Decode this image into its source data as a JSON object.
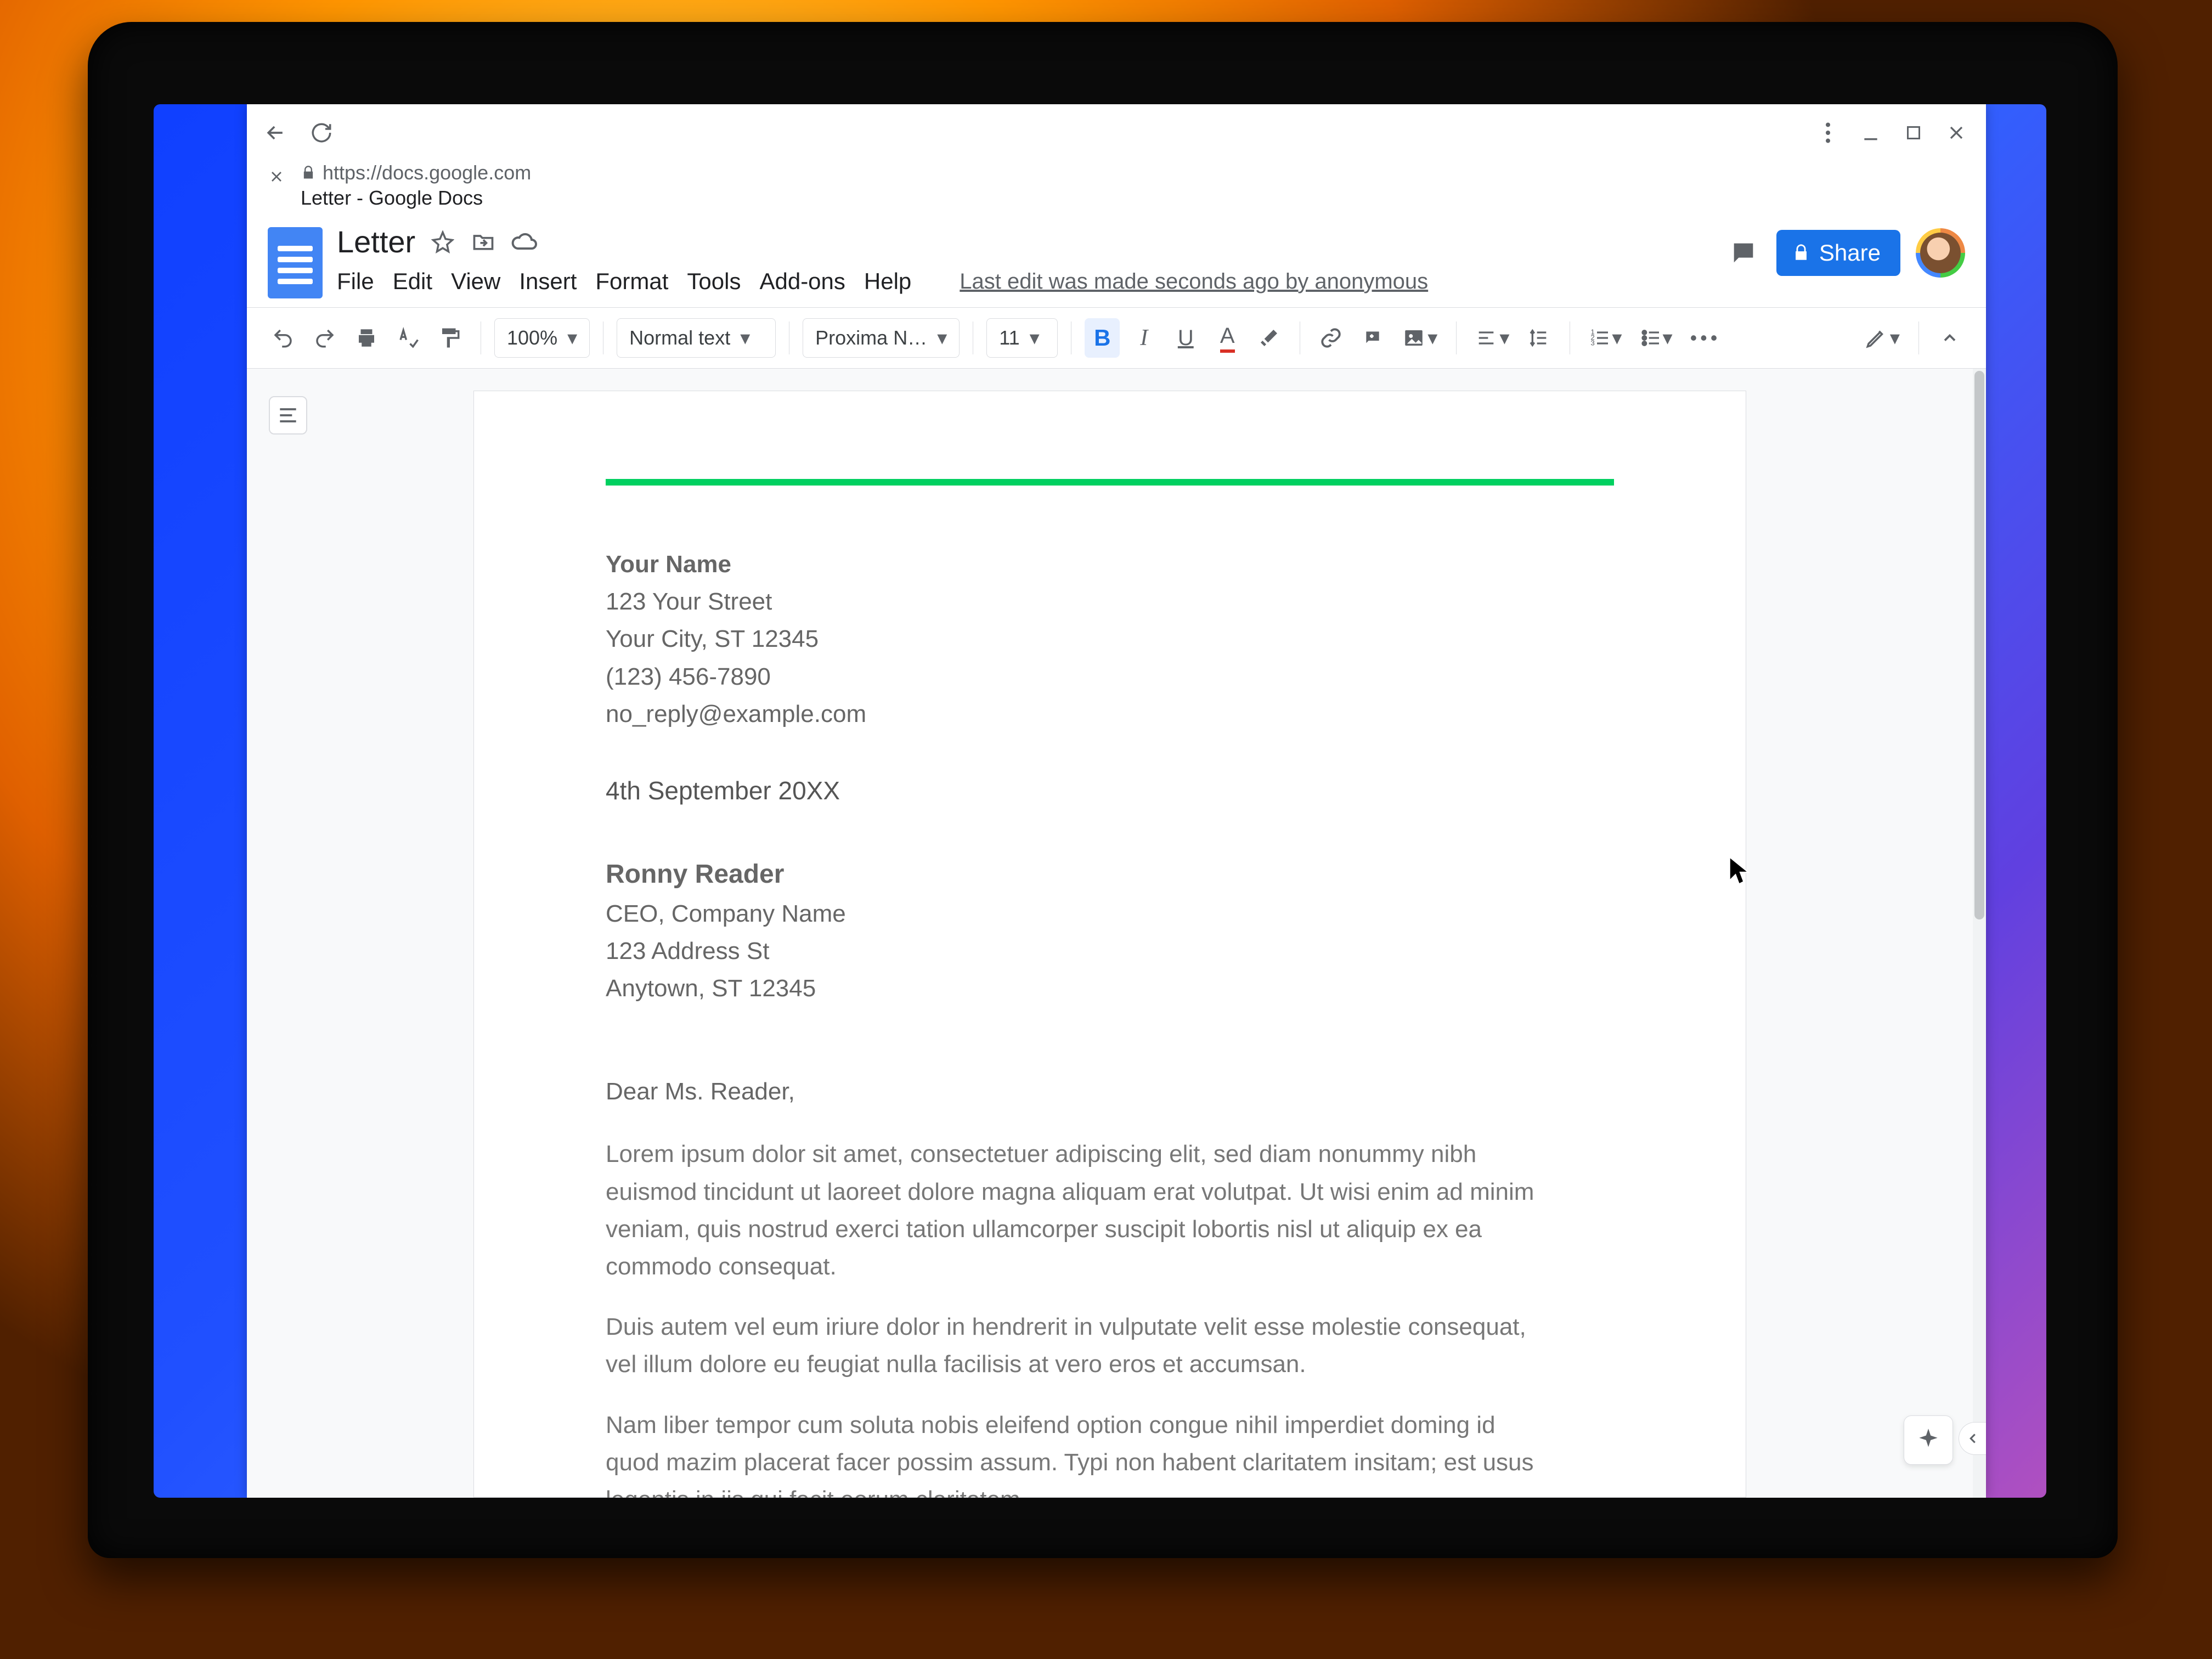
{
  "browser": {
    "url": "https://docs.google.com",
    "tab_title": "Letter - Google Docs"
  },
  "header": {
    "doc_title": "Letter",
    "menus": [
      "File",
      "Edit",
      "View",
      "Insert",
      "Format",
      "Tools",
      "Add-ons",
      "Help"
    ],
    "last_edit": "Last edit was made seconds ago by anonymous",
    "share_label": "Share"
  },
  "toolbar": {
    "zoom": "100%",
    "style": "Normal text",
    "font": "Proxima N…",
    "font_size": "11"
  },
  "document": {
    "accent_color": "#00d060",
    "sender": {
      "name": "Your Name",
      "street": "123 Your Street",
      "city": "Your City, ST 12345",
      "phone": "(123) 456-7890",
      "email": "no_reply@example.com"
    },
    "date": "4th September 20XX",
    "recipient": {
      "name": "Ronny Reader",
      "title": "CEO, Company Name",
      "street": "123 Address St",
      "city": "Anytown, ST 12345"
    },
    "salutation": "Dear Ms. Reader,",
    "paragraphs": [
      "Lorem ipsum dolor sit amet, consectetuer adipiscing elit, sed diam nonummy nibh euismod tincidunt ut laoreet dolore magna aliquam erat volutpat. Ut wisi enim ad minim veniam, quis nostrud exerci tation ullamcorper suscipit lobortis nisl ut aliquip ex ea commodo consequat.",
      "Duis autem vel eum iriure dolor in hendrerit in vulputate velit esse molestie consequat, vel illum dolore eu feugiat nulla facilisis at vero eros et accumsan.",
      "Nam liber tempor cum soluta nobis eleifend option congue nihil imperdiet doming id quod mazim placerat facer possim assum. Typi non habent claritatem insitam; est usus legentis in iis qui facit eorum claritatem."
    ]
  }
}
